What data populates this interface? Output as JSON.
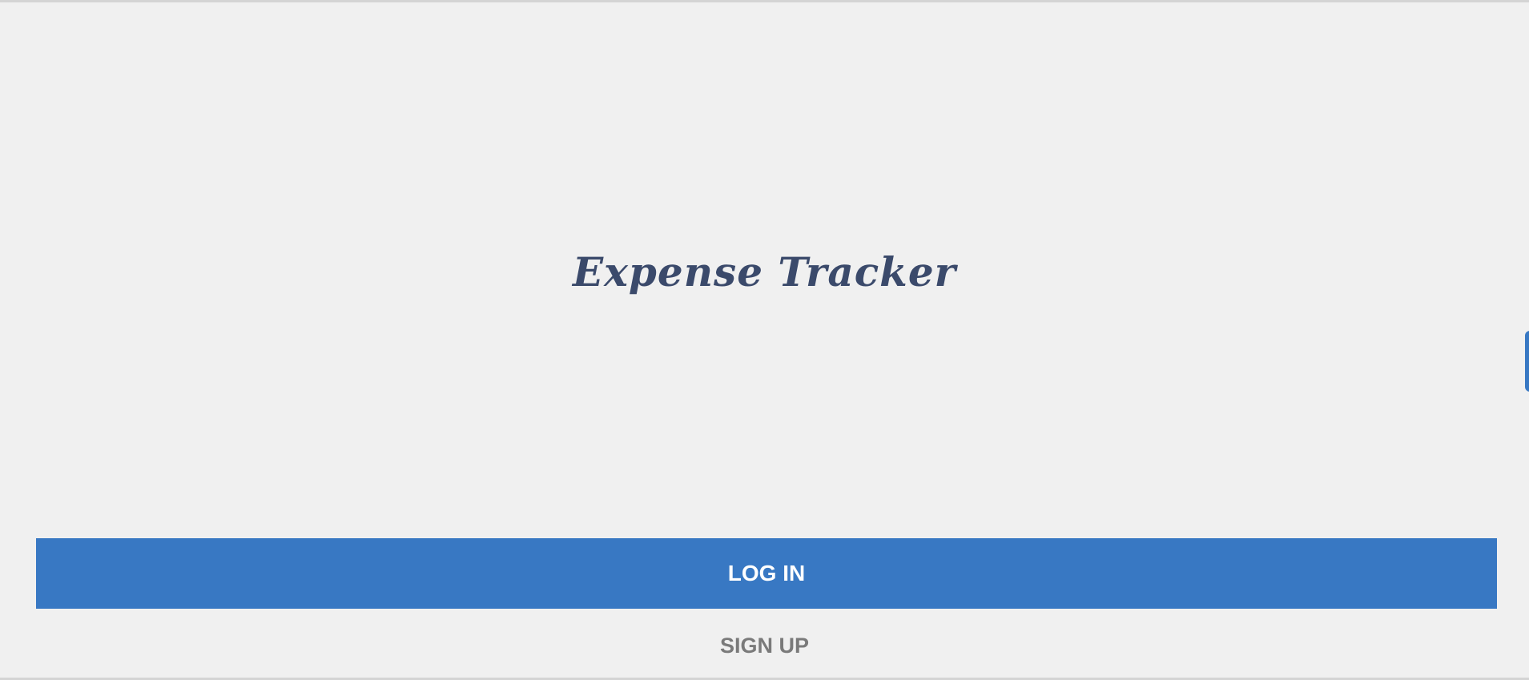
{
  "app": {
    "title": "Expense Tracker"
  },
  "actions": {
    "login_label": "LOG IN",
    "signup_label": "SIGN UP"
  },
  "colors": {
    "background": "#f0f0f0",
    "title_text": "#3b4a6b",
    "primary_button": "#3878c3",
    "primary_button_text": "#ffffff",
    "secondary_link_text": "#7a7a7a"
  }
}
